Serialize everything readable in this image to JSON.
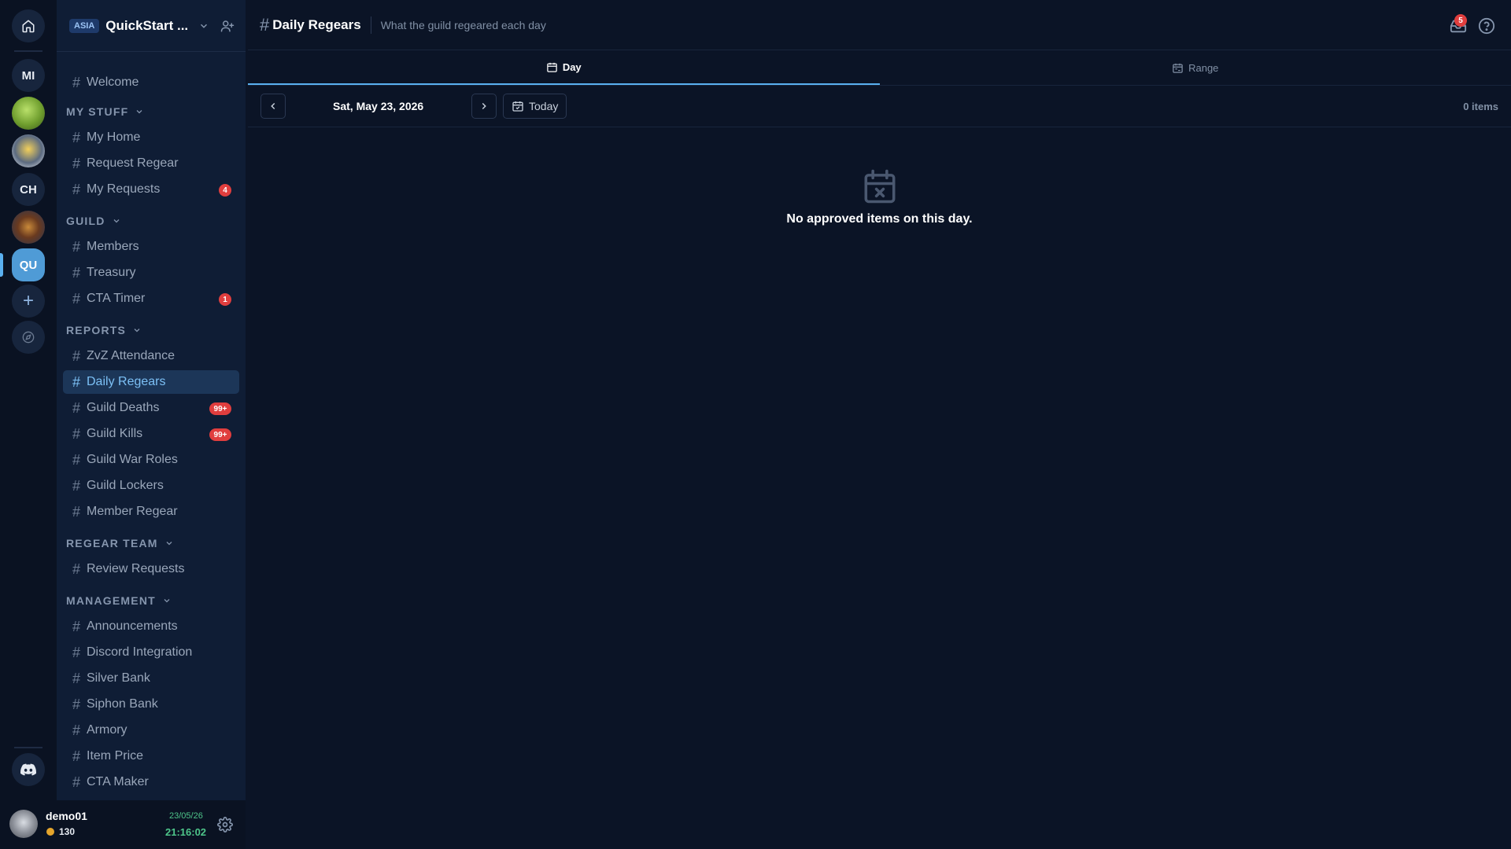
{
  "servers": {
    "home_icon": "home-icon",
    "items": [
      "MI",
      "CH",
      "QU"
    ],
    "add_symbol": "+"
  },
  "sidebar": {
    "region": "ASIA",
    "guild_name": "QuickStart ...",
    "channels": {
      "welcome": "Welcome",
      "my_home": "My Home",
      "request_regear": "Request Regear",
      "my_requests": "My Requests",
      "members": "Members",
      "treasury": "Treasury",
      "cta_timer": "CTA Timer",
      "zvz_attendance": "ZvZ Attendance",
      "daily_regears": "Daily Regears",
      "guild_deaths": "Guild Deaths",
      "guild_kills": "Guild Kills",
      "guild_war_roles": "Guild War Roles",
      "guild_lockers": "Guild Lockers",
      "member_regear": "Member Regear",
      "review_requests": "Review Requests",
      "announcements": "Announcements",
      "discord_integration": "Discord Integration",
      "silver_bank": "Silver Bank",
      "siphon_bank": "Siphon Bank",
      "armory": "Armory",
      "item_price": "Item Price",
      "cta_maker": "CTA Maker"
    },
    "badges": {
      "my_requests": "4",
      "cta_timer": "1",
      "guild_deaths": "99+",
      "guild_kills": "99+"
    },
    "sections": {
      "my_stuff": "MY STUFF",
      "guild": "GUILD",
      "reports": "REPORTS",
      "regear_team": "REGEAR TEAM",
      "management": "MANAGEMENT"
    }
  },
  "user": {
    "name": "demo01",
    "points": "130",
    "date": "23/05/26",
    "time": "21:16:02"
  },
  "header": {
    "hash": "#",
    "title": "Daily Regears",
    "subtitle": "What the guild regeared each day",
    "inbox_badge": "5"
  },
  "tabs": {
    "day": "Day",
    "range": "Range"
  },
  "datebar": {
    "date": "Sat, May 23, 2026",
    "today": "Today",
    "items_count": "0 items"
  },
  "empty_state": {
    "message": "No approved items on this day."
  },
  "colors": {
    "accent": "#5ab0f0",
    "badge": "#e03e3e",
    "background": "#0b1426",
    "sidebar": "#0f1d35",
    "time_green": "#4ec58a"
  }
}
